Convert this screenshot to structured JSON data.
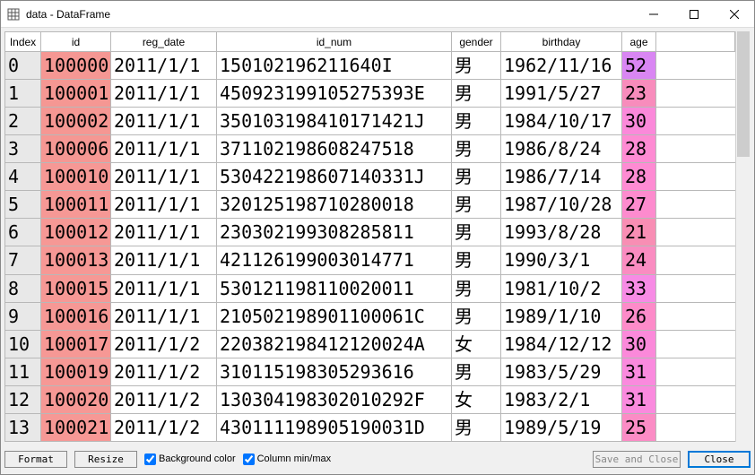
{
  "window": {
    "title": "data - DataFrame"
  },
  "headers": {
    "index": "Index",
    "id": "id",
    "reg_date": "reg_date",
    "id_num": "id_num",
    "gender": "gender",
    "birthday": "birthday",
    "age": "age"
  },
  "rows": [
    {
      "idx": "0",
      "id": "100000",
      "reg": "2011/1/1",
      "idnum": "150102196211640I",
      "gender": "男",
      "birth": "1962/11/16",
      "age": "52",
      "idbg": "#f59793",
      "agebg": "#d986f3"
    },
    {
      "idx": "1",
      "id": "100001",
      "reg": "2011/1/1",
      "idnum": "450923199105275393E",
      "gender": "男",
      "birth": "1991/5/27",
      "age": "23",
      "idbg": "#f59793",
      "agebg": "#f88cbc"
    },
    {
      "idx": "2",
      "id": "100002",
      "reg": "2011/1/1",
      "idnum": "350103198410171421J",
      "gender": "男",
      "birth": "1984/10/17",
      "age": "30",
      "idbg": "#f59793",
      "agebg": "#fb89da"
    },
    {
      "idx": "3",
      "id": "100006",
      "reg": "2011/1/1",
      "idnum": "371102198608247518",
      "gender": "男",
      "birth": "1986/8/24",
      "age": "28",
      "idbg": "#f59793",
      "agebg": "#fe8bd3"
    },
    {
      "idx": "4",
      "id": "100010",
      "reg": "2011/1/1",
      "idnum": "530422198607140331J",
      "gender": "男",
      "birth": "1986/7/14",
      "age": "28",
      "idbg": "#f69895",
      "agebg": "#fe8bd3"
    },
    {
      "idx": "5",
      "id": "100011",
      "reg": "2011/1/1",
      "idnum": "320125198710280018",
      "gender": "男",
      "birth": "1987/10/28",
      "age": "27",
      "idbg": "#f69895",
      "agebg": "#fd8bce"
    },
    {
      "idx": "6",
      "id": "100012",
      "reg": "2011/1/1",
      "idnum": "230302199308285811",
      "gender": "男",
      "birth": "1993/8/28",
      "age": "21",
      "idbg": "#f69895",
      "agebg": "#f88eb4"
    },
    {
      "idx": "7",
      "id": "100013",
      "reg": "2011/1/1",
      "idnum": "421126199003014771",
      "gender": "男",
      "birth": "1990/3/1",
      "age": "24",
      "idbg": "#f69895",
      "agebg": "#fa8cc1"
    },
    {
      "idx": "8",
      "id": "100015",
      "reg": "2011/1/1",
      "idnum": "530121198110020011",
      "gender": "男",
      "birth": "1981/10/2",
      "age": "33",
      "idbg": "#f69895",
      "agebg": "#f78be5"
    },
    {
      "idx": "9",
      "id": "100016",
      "reg": "2011/1/1",
      "idnum": "210502198901100061C",
      "gender": "男",
      "birth": "1989/1/10",
      "age": "26",
      "idbg": "#f69895",
      "agebg": "#fd8bc9"
    },
    {
      "idx": "10",
      "id": "100017",
      "reg": "2011/1/2",
      "idnum": "220382198412120024A",
      "gender": "女",
      "birth": "1984/12/12",
      "age": "30",
      "idbg": "#f69895",
      "agebg": "#fb89da"
    },
    {
      "idx": "11",
      "id": "100019",
      "reg": "2011/1/2",
      "idnum": "310115198305293616",
      "gender": "男",
      "birth": "1983/5/29",
      "age": "31",
      "idbg": "#f69895",
      "agebg": "#fa8ade"
    },
    {
      "idx": "12",
      "id": "100020",
      "reg": "2011/1/2",
      "idnum": "130304198302010292F",
      "gender": "女",
      "birth": "1983/2/1",
      "age": "31",
      "idbg": "#f69895",
      "agebg": "#fa8ade"
    },
    {
      "idx": "13",
      "id": "100021",
      "reg": "2011/1/2",
      "idnum": "430111198905190031D",
      "gender": "男",
      "birth": "1989/5/19",
      "age": "25",
      "idbg": "#f69895",
      "agebg": "#fb8cc5"
    }
  ],
  "footer": {
    "format": "Format",
    "resize": "Resize",
    "bgcolor": "Background color",
    "colminmax": "Column min/max",
    "saveclose": "Save and Close",
    "close": "Close"
  },
  "chart_data": {
    "type": "table",
    "title": "data - DataFrame",
    "columns": [
      "Index",
      "id",
      "reg_date",
      "id_num",
      "gender",
      "birthday",
      "age"
    ],
    "rows": [
      [
        0,
        100000,
        "2011/1/1",
        "150102196211640I",
        "男",
        "1962/11/16",
        52
      ],
      [
        1,
        100001,
        "2011/1/1",
        "450923199105275393E",
        "男",
        "1991/5/27",
        23
      ],
      [
        2,
        100002,
        "2011/1/1",
        "350103198410171421J",
        "男",
        "1984/10/17",
        30
      ],
      [
        3,
        100006,
        "2011/1/1",
        "371102198608247518",
        "男",
        "1986/8/24",
        28
      ],
      [
        4,
        100010,
        "2011/1/1",
        "530422198607140331J",
        "男",
        "1986/7/14",
        28
      ],
      [
        5,
        100011,
        "2011/1/1",
        "320125198710280018",
        "男",
        "1987/10/28",
        27
      ],
      [
        6,
        100012,
        "2011/1/1",
        "230302199308285811",
        "男",
        "1993/8/28",
        21
      ],
      [
        7,
        100013,
        "2011/1/1",
        "421126199003014771",
        "男",
        "1990/3/1",
        24
      ],
      [
        8,
        100015,
        "2011/1/1",
        "530121198110020011",
        "男",
        "1981/10/2",
        33
      ],
      [
        9,
        100016,
        "2011/1/1",
        "210502198901100061C",
        "男",
        "1989/1/10",
        26
      ],
      [
        10,
        100017,
        "2011/1/2",
        "220382198412120024A",
        "女",
        "1984/12/12",
        30
      ],
      [
        11,
        100019,
        "2011/1/2",
        "310115198305293616",
        "男",
        "1983/5/29",
        31
      ],
      [
        12,
        100020,
        "2011/1/2",
        "130304198302010292F",
        "女",
        "1983/2/1",
        31
      ],
      [
        13,
        100021,
        "2011/1/2",
        "430111198905190031D",
        "男",
        "1989/5/19",
        25
      ]
    ]
  }
}
